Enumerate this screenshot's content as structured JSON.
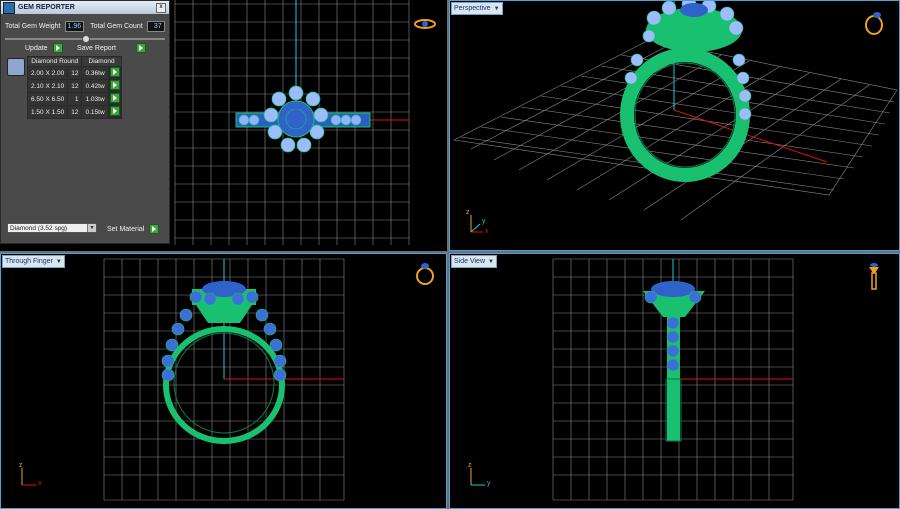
{
  "gem_reporter": {
    "title": "GEM REPORTER",
    "close_label": "x",
    "total_weight_label": "Total Gem Weight",
    "total_weight_value": "1.96",
    "total_count_label": "Total Gem Count",
    "total_count_value": "37",
    "update_label": "Update",
    "save_report_label": "Save Report",
    "table_headers": [
      "Diamond Round",
      "Diamond"
    ],
    "rows": [
      {
        "size": "2.00 X 2.00",
        "count": "12",
        "weight": "0.36tw"
      },
      {
        "size": "2.10 X 2.10",
        "count": "12",
        "weight": "0.42tw"
      },
      {
        "size": "6.50 X 6.50",
        "count": "1",
        "weight": "1.03tw"
      },
      {
        "size": "1.50 X 1.50",
        "count": "12",
        "weight": "0.15tw"
      }
    ],
    "material_value": "Diamond    (3.52 spg)",
    "set_material_label": "Set Material"
  },
  "viewports": {
    "perspective": {
      "label": "Perspective"
    },
    "through_finger": {
      "label": "Through Finger"
    },
    "side_view": {
      "label": "Side View"
    }
  },
  "axes": {
    "x": "x",
    "y": "y",
    "z": "z"
  },
  "colors": {
    "grid": "#cfcfcf",
    "wire": "#18c070",
    "gem": "#2f63c9",
    "halo": "#9dbbff",
    "axis_x": "#e01010",
    "axis_y": "#1ec8e0",
    "border": "#4aa3d8",
    "ring_icon": "#f0a020"
  }
}
